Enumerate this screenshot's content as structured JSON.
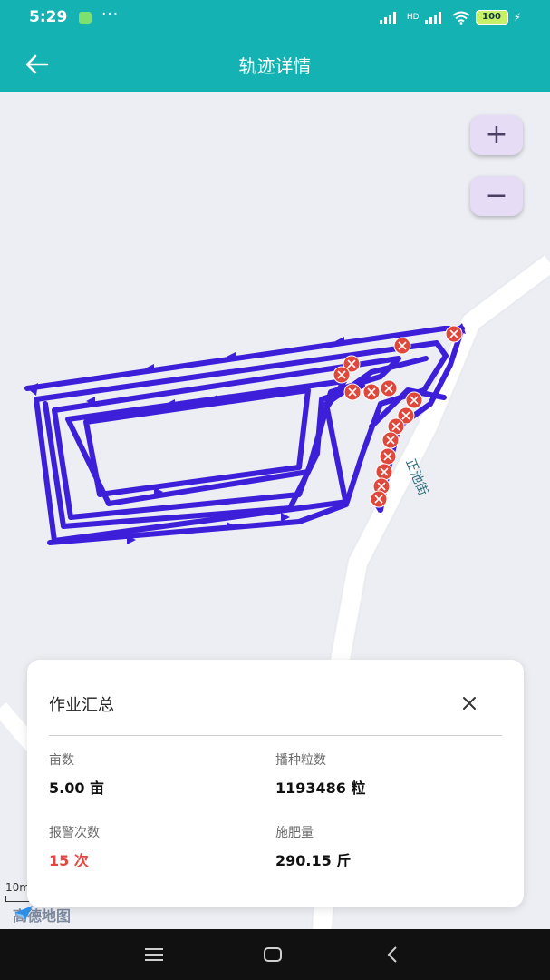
{
  "status_bar": {
    "time": "5:29",
    "dots": "···",
    "network": "HD",
    "battery": "100"
  },
  "app_bar": {
    "title": "轨迹详情",
    "back_icon": "arrow-left-icon"
  },
  "map": {
    "street_label": "正池街",
    "scale_label": "10m",
    "logo_text": "高德地图",
    "zoom_in_label": "+",
    "zoom_out_label": "−",
    "track_color": "#3d1fd9",
    "alarm_marker_color": "#e0483c"
  },
  "summary": {
    "title": "作业汇总",
    "close_icon": "close-icon",
    "area_label": "亩数",
    "area_value": "5.00 亩",
    "seed_label": "播种粒数",
    "seed_value": "1193486 粒",
    "alarm_label": "报警次数",
    "alarm_value": "15 次",
    "fert_label": "施肥量",
    "fert_value": "290.15 斤"
  },
  "nav_bar": {
    "menu_icon": "menu-icon",
    "home_icon": "home-icon",
    "back_icon": "back-triangle-icon"
  }
}
